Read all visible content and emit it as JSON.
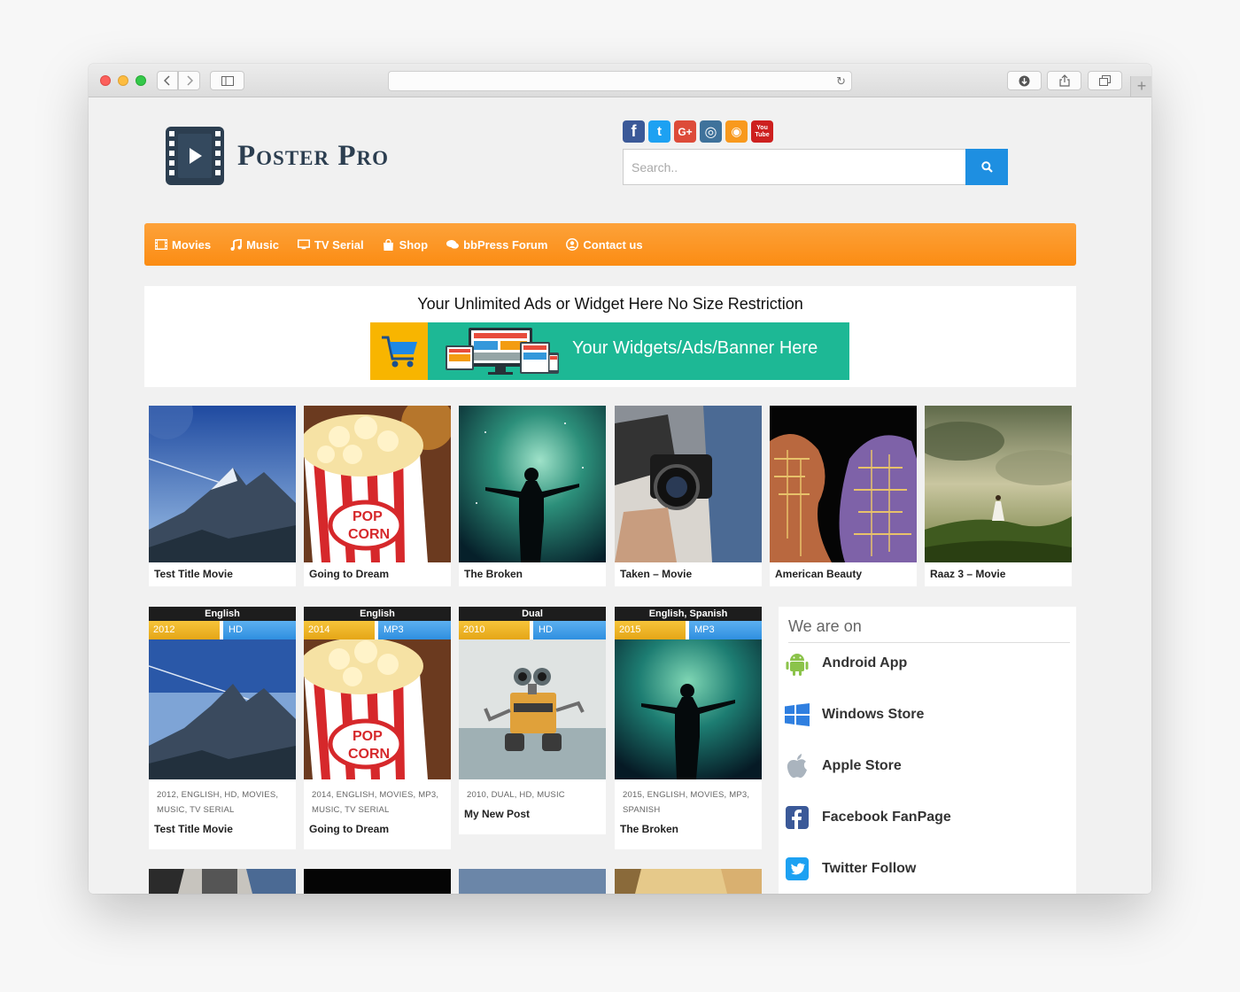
{
  "site": {
    "title": "Poster Pro"
  },
  "social_icons": [
    {
      "icon": "facebook-icon",
      "color": "#3b5998",
      "glyph": "f"
    },
    {
      "icon": "twitter-icon",
      "color": "#1da1f2",
      "glyph": "t"
    },
    {
      "icon": "google-plus-icon",
      "color": "#dd4b39",
      "glyph": "G+"
    },
    {
      "icon": "instagram-icon",
      "color": "#3f729b",
      "glyph": "◎"
    },
    {
      "icon": "rss-icon",
      "color": "#f8991d",
      "glyph": "◉"
    },
    {
      "icon": "youtube-icon",
      "color": "#cd201f",
      "glyph": "You Tube"
    }
  ],
  "search": {
    "placeholder": "Search.."
  },
  "nav": [
    {
      "label": "Movies",
      "icon": "film-icon"
    },
    {
      "label": "Music",
      "icon": "music-icon"
    },
    {
      "label": "TV Serial",
      "icon": "tv-icon"
    },
    {
      "label": "Shop",
      "icon": "shopping-bag-icon"
    },
    {
      "label": "bbPress Forum",
      "icon": "comments-icon"
    },
    {
      "label": "Contact us",
      "icon": "user-circle-icon"
    }
  ],
  "ad": {
    "title": "Your Unlimited Ads or Widget Here No Size Restriction",
    "banner_text": "Your Widgets/Ads/Banner Here"
  },
  "row1": [
    {
      "title": "Test Title Movie"
    },
    {
      "title": "Going to Dream"
    },
    {
      "title": "The Broken"
    },
    {
      "title": "Taken – Movie"
    },
    {
      "title": "American Beauty"
    },
    {
      "title": "Raaz 3 – Movie"
    }
  ],
  "row2": [
    {
      "lang": "English",
      "year": "2012",
      "quality": "HD",
      "tags_line1": "2012, ENGLISH, HD, MOVIES,",
      "tags_line2": "MUSIC, TV SERIAL",
      "title": "Test Title Movie"
    },
    {
      "lang": "English",
      "year": "2014",
      "quality": "MP3",
      "tags_line1": "2014, ENGLISH, MOVIES, MP3,",
      "tags_line2": "MUSIC, TV SERIAL",
      "title": "Going to Dream"
    },
    {
      "lang": "Dual",
      "year": "2010",
      "quality": "HD",
      "tags_line1": "2010, DUAL, HD, MUSIC",
      "tags_line2": "",
      "title": "My New Post"
    },
    {
      "lang": "English, Spanish",
      "year": "2015",
      "quality": "MP3",
      "tags_line1": "2015, ENGLISH, MOVIES, MP3,",
      "tags_line2": "SPANISH",
      "title": "The Broken"
    }
  ],
  "sidebar": {
    "title": "We are on",
    "items": [
      {
        "label": "Android App",
        "icon": "android-icon",
        "color": "#8bc34a"
      },
      {
        "label": "Windows Store",
        "icon": "windows-icon",
        "color": "#2f7fe0"
      },
      {
        "label": "Apple Store",
        "icon": "apple-icon",
        "color": "#aab4be"
      },
      {
        "label": "Facebook FanPage",
        "icon": "facebook-icon",
        "color": "#3b5998"
      },
      {
        "label": "Twitter Follow",
        "icon": "twitter-icon",
        "color": "#1da1f2"
      }
    ]
  }
}
